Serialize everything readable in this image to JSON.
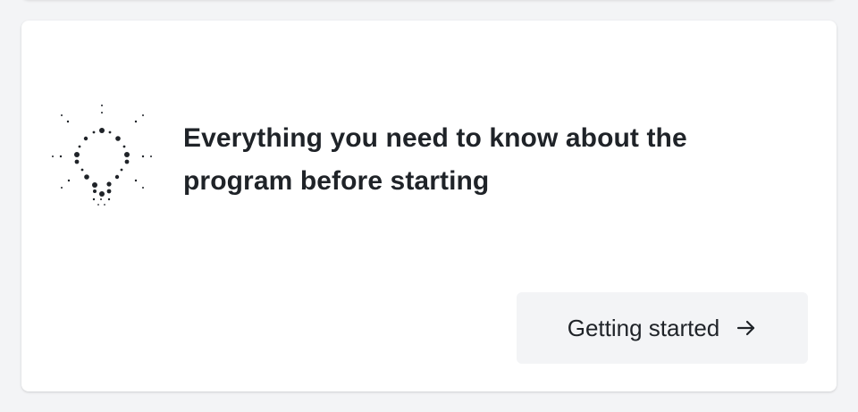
{
  "card": {
    "headline": "Everything you need to know about the program before starting",
    "icon": "lightbulb-icon",
    "button": {
      "label": "Getting started",
      "icon": "arrow-right-icon"
    }
  },
  "colors": {
    "background": "#f3f4f6",
    "card": "#ffffff",
    "text": "#1f2328",
    "button_bg": "#f3f4f6"
  }
}
